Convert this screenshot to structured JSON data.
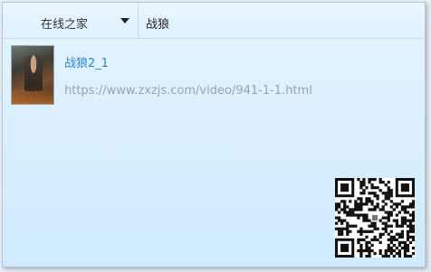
{
  "toolbar": {
    "source_label": "在线之家",
    "query": "战狼"
  },
  "results": [
    {
      "title": "战狼2_1",
      "url": "https://www.zxzjs.com/video/941-1-1.html"
    }
  ],
  "icons": {
    "dropdown": "chevron-down-icon",
    "qr": "qr-code-icon"
  },
  "colors": {
    "link": "#2c86d1",
    "url": "#9aa3ab",
    "background": "#dff1ff"
  }
}
